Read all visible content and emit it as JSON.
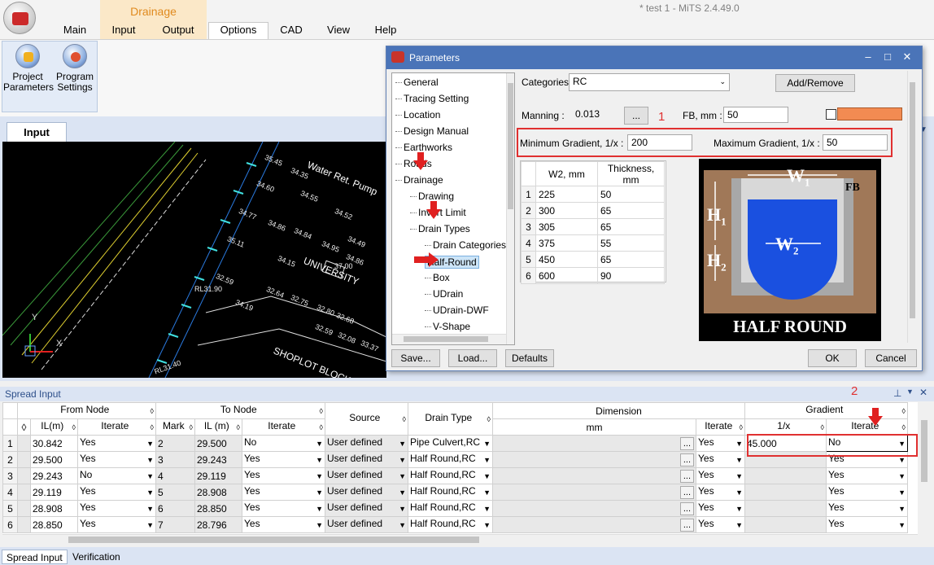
{
  "window": {
    "title": "* test 1 - MiTS 2.4.49.0"
  },
  "ribbon": {
    "context_group": "Drainage",
    "tabs": [
      "Main",
      "Input",
      "Output",
      "Options",
      "CAD",
      "View",
      "Help"
    ],
    "buttons": {
      "project_parameters": "Project\nParameters",
      "program_settings": "Program\nSettings"
    }
  },
  "input_panel": {
    "tab": "Input",
    "cad_labels": [
      "Water Ret. Pump",
      "UNIVERSITY",
      "SHOPLOT BLOCK",
      "RL31.90",
      "RL31.40",
      "37.00",
      "35.45",
      "34.35",
      "34.60",
      "34.55",
      "34.52",
      "34.77",
      "34.86",
      "34.84",
      "34.49",
      "35.11",
      "34.15",
      "34.95",
      "34.86",
      "32.59",
      "32.64",
      "32.75",
      "34.19",
      "32.80",
      "32.68",
      "32.59",
      "32.08",
      "33.37"
    ]
  },
  "dialog": {
    "title": "Parameters",
    "tree": [
      "General",
      "Tracing Setting",
      "Location",
      "Design Manual",
      "Earthworks",
      "Roads",
      "Drainage",
      "Drawing",
      "Invert Limit",
      "Drain Types",
      "Drain Categories",
      "Half-Round",
      "Box",
      "UDrain",
      "UDrain-DWF",
      "V-Shape"
    ],
    "categories_label": "Categories",
    "categories_value": "RC",
    "add_remove": "Add/Remove",
    "manning_label": "Manning :",
    "manning_value": "0.013",
    "dots": "...",
    "fb_label": "FB, mm :",
    "fb_value": "50",
    "callout_1": "1",
    "min_grad_label": "Minimum Gradient, 1/x :",
    "min_grad_value": "200",
    "max_grad_label": "Maximum Gradient, 1/x :",
    "max_grad_value": "50",
    "grid_headers": [
      "W2, mm",
      "Thickness, mm"
    ],
    "grid_rows": [
      [
        "1",
        "225",
        "50"
      ],
      [
        "2",
        "300",
        "65"
      ],
      [
        "3",
        "305",
        "65"
      ],
      [
        "4",
        "375",
        "55"
      ],
      [
        "5",
        "450",
        "65"
      ],
      [
        "6",
        "600",
        "90"
      ]
    ],
    "diagram": {
      "w1": "W",
      "w1_sub": "1",
      "fb": "FB",
      "h1": "H",
      "h1_sub": "1",
      "h2": "H",
      "h2_sub": "2",
      "w2": "W",
      "w2_sub": "2",
      "caption": "HALF ROUND"
    },
    "buttons": {
      "save": "Save...",
      "load": "Load...",
      "defaults": "Defaults",
      "ok": "OK",
      "cancel": "Cancel"
    },
    "colors": {
      "swatch": "#f28b52",
      "titlebar": "#4a74b8"
    }
  },
  "spread": {
    "title": "Spread Input",
    "callout_2": "2",
    "group_headers": {
      "from_node": "From Node",
      "to_node": "To Node",
      "source": "Source",
      "drain_type": "Drain Type",
      "dimension": "Dimension",
      "dimension_unit": "mm",
      "gradient": "Gradient"
    },
    "sub_headers": {
      "il_m": "IL(m)",
      "iterate": "Iterate",
      "mark": "Mark",
      "il_m2": "IL (m)",
      "iterate2": "Iterate",
      "iterate3": "Iterate",
      "inv_x": "1/x",
      "iterate4": "Iterate"
    },
    "rows": [
      {
        "n": "1",
        "from_il": "30.842",
        "from_it": "Yes",
        "mark": "2",
        "to_il": "29.500",
        "to_it": "No",
        "source": "User defined",
        "drain": "Pipe Culvert,RC",
        "dim_it": "Yes",
        "grad": "45.000",
        "grad_it": "No"
      },
      {
        "n": "2",
        "from_il": "29.500",
        "from_it": "Yes",
        "mark": "3",
        "to_il": "29.243",
        "to_it": "Yes",
        "source": "User defined",
        "drain": "Half Round,RC",
        "dim_it": "Yes",
        "grad": "",
        "grad_it": "Yes"
      },
      {
        "n": "3",
        "from_il": "29.243",
        "from_it": "No",
        "mark": "4",
        "to_il": "29.119",
        "to_it": "Yes",
        "source": "User defined",
        "drain": "Half Round,RC",
        "dim_it": "Yes",
        "grad": "",
        "grad_it": "Yes"
      },
      {
        "n": "4",
        "from_il": "29.119",
        "from_it": "Yes",
        "mark": "5",
        "to_il": "28.908",
        "to_it": "Yes",
        "source": "User defined",
        "drain": "Half Round,RC",
        "dim_it": "Yes",
        "grad": "",
        "grad_it": "Yes"
      },
      {
        "n": "5",
        "from_il": "28.908",
        "from_it": "Yes",
        "mark": "6",
        "to_il": "28.850",
        "to_it": "Yes",
        "source": "User defined",
        "drain": "Half Round,RC",
        "dim_it": "Yes",
        "grad": "",
        "grad_it": "Yes"
      },
      {
        "n": "6",
        "from_il": "28.850",
        "from_it": "Yes",
        "mark": "7",
        "to_il": "28.796",
        "to_it": "Yes",
        "source": "User defined",
        "drain": "Half Round,RC",
        "dim_it": "Yes",
        "grad": "",
        "grad_it": "Yes"
      }
    ],
    "bottom_tabs": [
      "Spread Input",
      "Verification"
    ]
  }
}
